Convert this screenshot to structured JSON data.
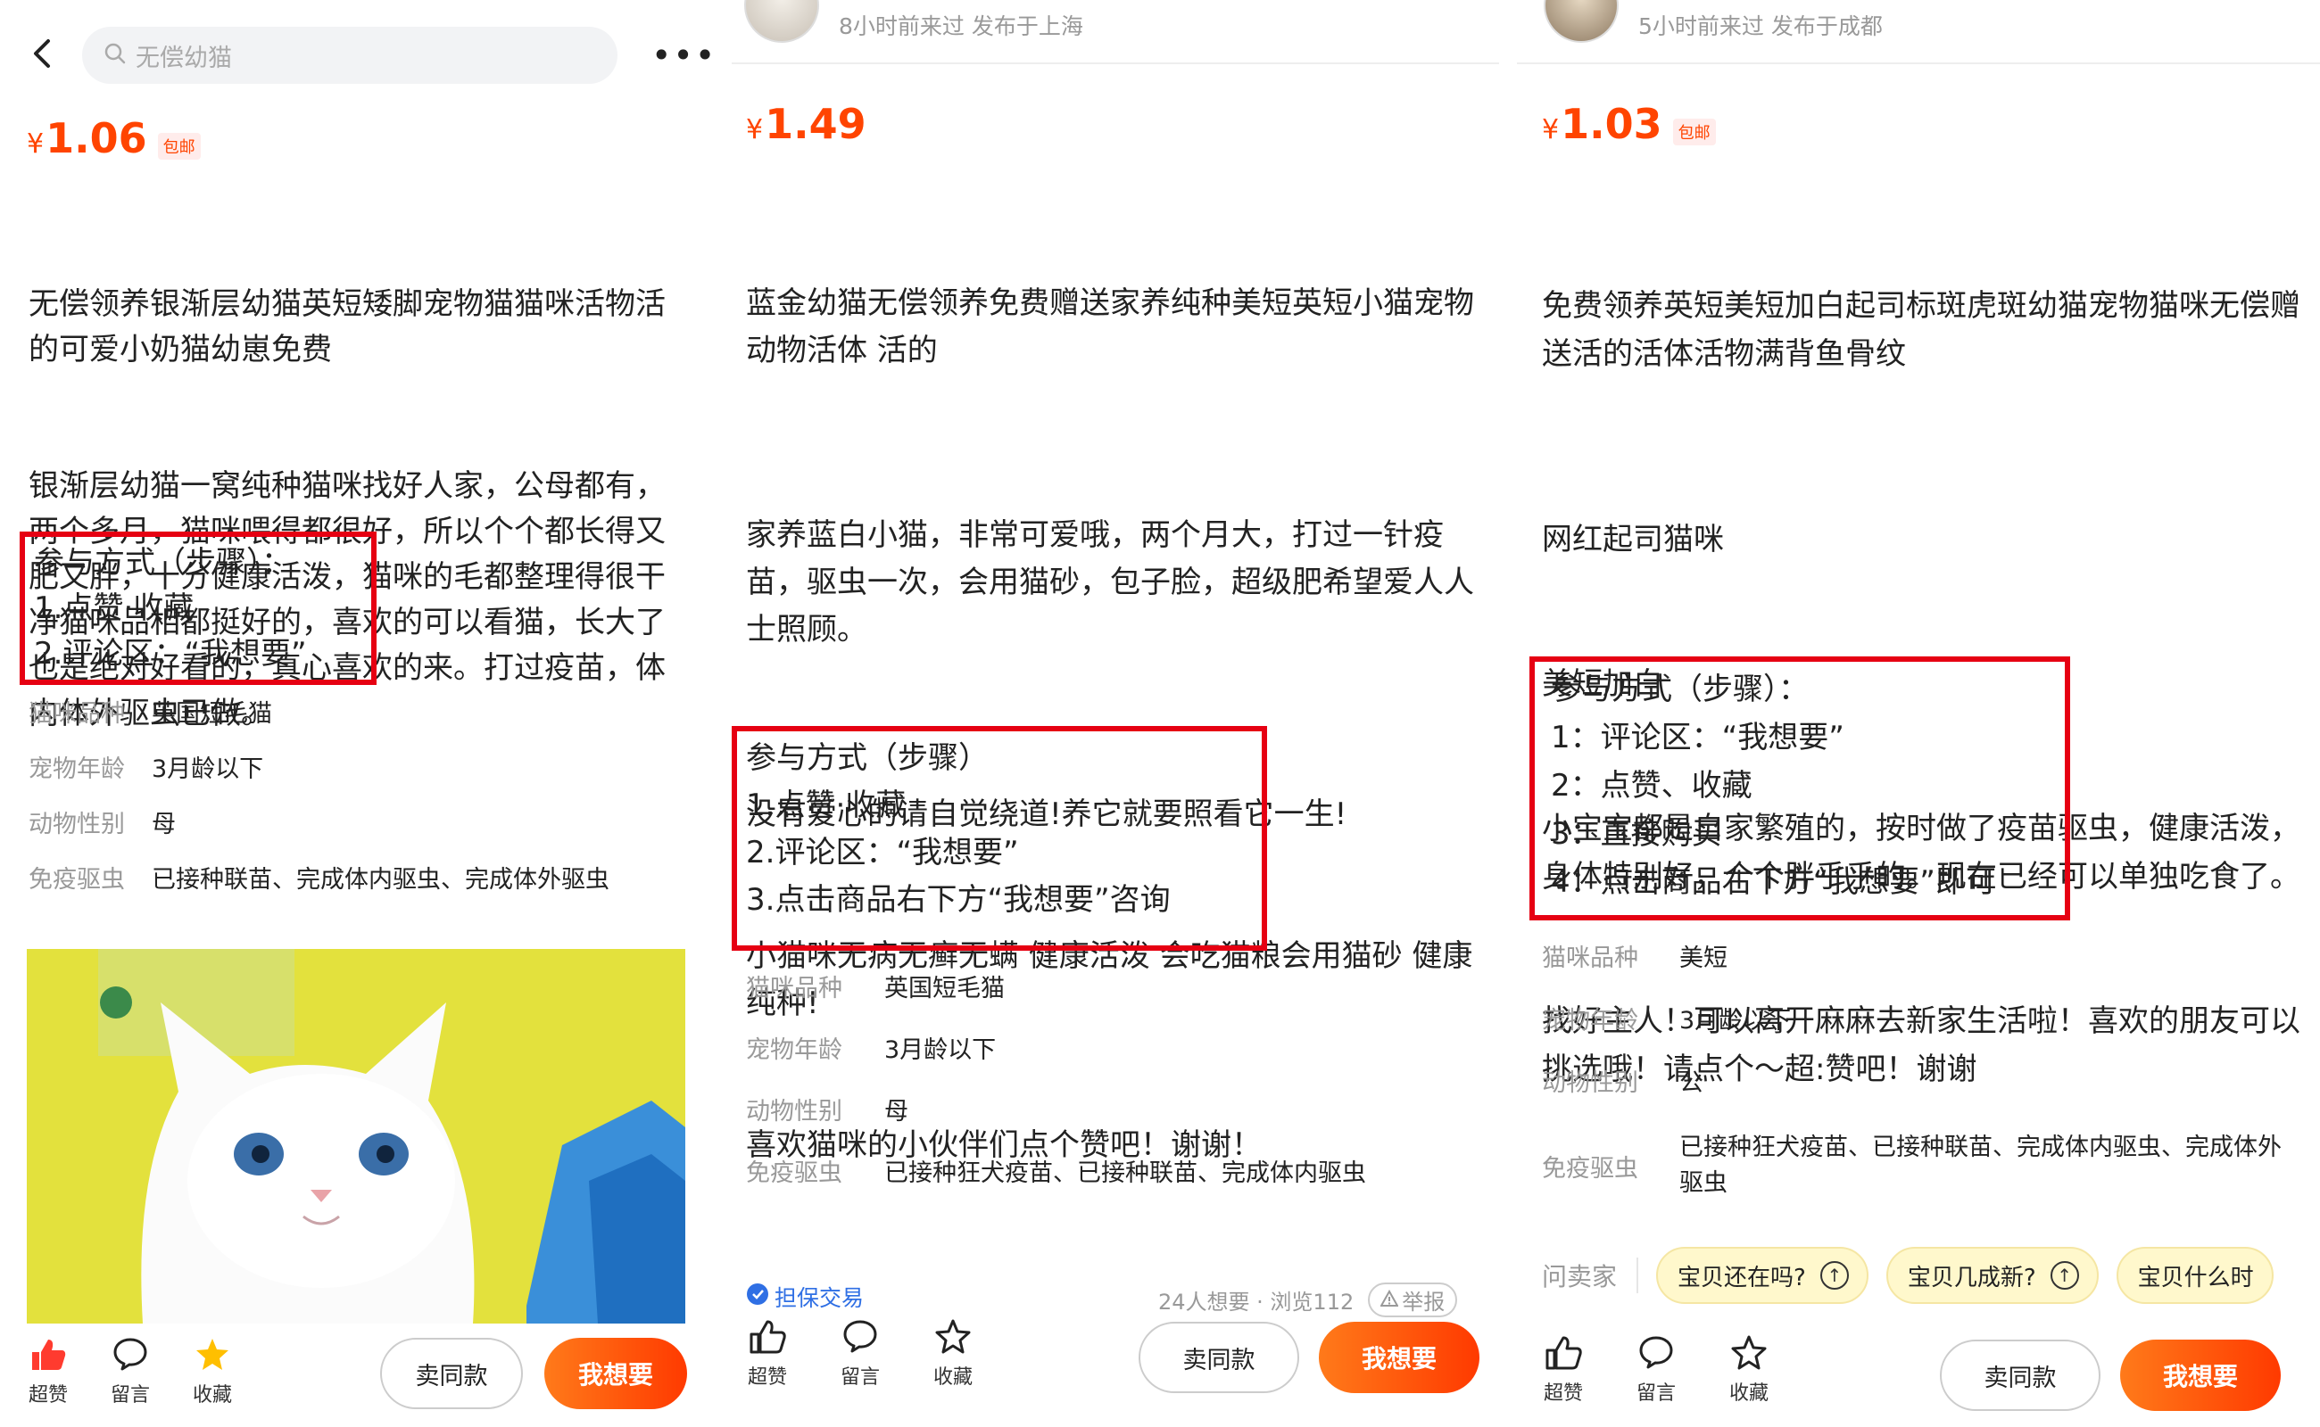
{
  "panel1": {
    "search_placeholder": "无偿幼猫",
    "more": "•••",
    "price": {
      "currency": "¥",
      "amount": "1.06",
      "tag": "包邮"
    },
    "title": "无偿领养银渐层幼猫英短矮脚宠物猫猫咪活物活的可爱小奶猫幼崽免费",
    "body": "银渐层幼猫一窝纯种猫咪找好人家，公母都有，两个多月，猫咪喂得都很好，所以个个都长得又肥又胖，十分健康活泼，猫咪的毛都整理得很干净猫咪品相都挺好的，喜欢的可以看猫，长大了也是绝对好看的，真心喜欢的来。打过疫苗，体内体外驱虫已做。",
    "steps": [
      "参与方式（步骤）：",
      "1.点赞·收藏",
      "2.评论区：“我想要”"
    ],
    "attrs": [
      {
        "k": "猫咪品种",
        "v": "英国短毛猫"
      },
      {
        "k": "宠物年龄",
        "v": "3月龄以下"
      },
      {
        "k": "动物性别",
        "v": "母"
      },
      {
        "k": "免疫驱虫",
        "v": "已接种联苗、完成体内驱虫、完成体外驱虫"
      }
    ],
    "actions": {
      "like": "超赞",
      "comment": "留言",
      "fav": "收藏"
    },
    "btn_same": "卖同款",
    "btn_want": "我想要"
  },
  "panel2": {
    "seller_meta": "8小时前来过  发布于上海",
    "price": {
      "currency": "¥",
      "amount": "1.49"
    },
    "title": "蓝金幼猫无偿领养免费赠送家养纯种美短英短小猫宠物动物活体 活的",
    "para1": "家养蓝白小猫，非常可爱哦，两个月大，打过一针疫苗，驱虫一次，会用猫砂，包子脸，超级肥希望爱人人士照顾。",
    "para2": [
      "没有爱心的请自觉绕道!养它就要照看它一生!",
      "小猫咪无病无癣无螨 健康活泼 会吃猫粮会用猫砂 健康纯种!",
      "喜欢猫咪的小伙伴们点个赞吧！谢谢！"
    ],
    "steps": [
      "参与方式（步骤）",
      "1.点赞·收藏",
      "2.评论区：“我想要”",
      "3.点击商品右下方“我想要”咨询"
    ],
    "attrs": [
      {
        "k": "猫咪品种",
        "v": "英国短毛猫"
      },
      {
        "k": "宠物年龄",
        "v": "3月龄以下"
      },
      {
        "k": "动物性别",
        "v": "母"
      },
      {
        "k": "免疫驱虫",
        "v": "已接种狂犬疫苗、已接种联苗、完成体内驱虫"
      }
    ],
    "guarantee": "担保交易",
    "stats": "24人想要 · 浏览112",
    "report": "举报",
    "actions": {
      "like": "超赞",
      "comment": "留言",
      "fav": "收藏"
    },
    "btn_same": "卖同款",
    "btn_want": "我想要"
  },
  "panel3": {
    "seller_meta": "5小时前来过  发布于成都",
    "price": {
      "currency": "¥",
      "amount": "1.03",
      "tag": "包邮"
    },
    "title": "免费领养英短美短加白起司标斑虎斑幼猫宠物猫咪无偿赠送活的活体活物满背鱼骨纹",
    "lines": [
      "网红起司猫咪",
      "美短加白",
      "小宝宝都是自家繁殖的，按时做了疫苗驱虫，健康活泼，身体特别好，个个胖乎乎的。现在已经可以单独吃食了。",
      "找好主人！可以离开麻麻去新家生活啦！喜欢的朋友可以挑选哦！请点个～超:赞吧！谢谢"
    ],
    "steps": [
      "参与方式（步骤）：",
      "1：评论区：“我想要”",
      "2：点赞、收藏",
      "3：直接购买",
      "4：点击商品右下方“我想要”即可"
    ],
    "attrs": [
      {
        "k": "猫咪品种",
        "v": "美短"
      },
      {
        "k": "宠物年龄",
        "v": "3月龄以下"
      },
      {
        "k": "动物性别",
        "v": "公"
      },
      {
        "k": "免疫驱虫",
        "v": "已接种狂犬疫苗、已接种联苗、完成体内驱虫、完成体外驱虫"
      }
    ],
    "ask_label": "问卖家",
    "chips": [
      "宝贝还在吗?",
      "宝贝几成新?",
      "宝贝什么时"
    ],
    "actions": {
      "like": "超赞",
      "comment": "留言",
      "fav": "收藏"
    },
    "btn_same": "卖同款",
    "btn_want": "我想要"
  },
  "colors": {
    "accent": "#ff4400",
    "highlight_border": "#e60012",
    "link_blue": "#2f6fe4"
  }
}
